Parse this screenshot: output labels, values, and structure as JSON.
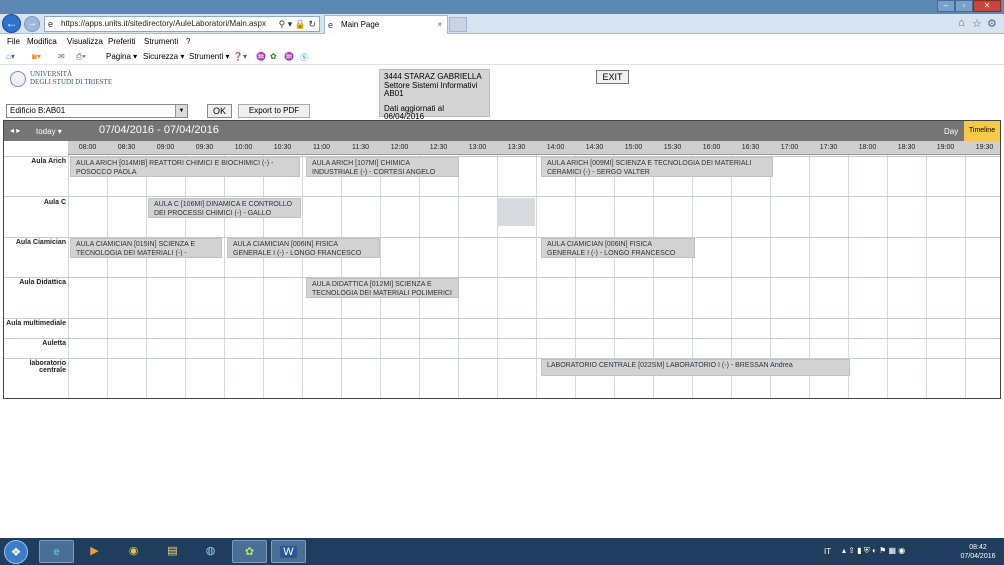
{
  "browser": {
    "address": "https://apps.units.it/sitedirectory/AuleLaboratori/Main.aspx",
    "tab_title": "Main Page",
    "tab_close": "×",
    "search_glyph": "⚲ ▾ 🔒 ↻"
  },
  "menu": [
    "File",
    "Modifica",
    "Visualizza",
    "Preferiti",
    "Strumenti",
    "?"
  ],
  "commandbar": {
    "pagina": "Pagina ▾",
    "sicurezza": "Sicurezza ▾",
    "strumenti": "Strumenti ▾"
  },
  "logo": {
    "line1": "UNIVERSITÀ",
    "line2": "DEGLI STUDI DI TRIESTE"
  },
  "user": {
    "line1": "3444  STARAZ  GABRIELLA",
    "line2": "Settore Sistemi Informativi",
    "line3": "AB01",
    "line4": "Dati aggiornati al 06/04/2016"
  },
  "exit_label": "EXIT",
  "building_select": "Edificio B:AB01",
  "ok_label": "OK",
  "pdf_label": "Export to PDF",
  "scheduler": {
    "nav": "◂ ▸",
    "today": "today  ▾",
    "range": "07/04/2016 - 07/04/2016",
    "day_view": "Day",
    "timeline_view": "Timeline",
    "times": [
      "08:00",
      "08:30",
      "09:00",
      "09:30",
      "10:00",
      "10:30",
      "11:00",
      "11:30",
      "12:00",
      "12:30",
      "13:00",
      "13:30",
      "14:00",
      "14:30",
      "15:00",
      "15:30",
      "16:00",
      "16:30",
      "17:00",
      "17:30",
      "18:00",
      "18:30",
      "19:00",
      "19:30"
    ],
    "rooms": [
      "Aula Arich",
      "Aula C",
      "Aula Ciamician",
      "Aula Didattica",
      "Aula multimediale",
      "Auletta",
      "laboratorio centrale"
    ],
    "events": [
      "AULA ARICH [014MIB] REATTORI CHIMICI E BIOCHIMICI (-) - POSOCCO PAOLA",
      "AULA ARICH [107MI] CHIMICA INDUSTRIALE (-) - CORTESI ANGELO",
      "AULA ARICH [009MI] SCIENZA E TECNOLOGIA DEI MATERIALI CERAMICI (-) - SERGO VALTER",
      "AULA C [106MI] DINAMICA E CONTROLLO DEI PROCESSI CHIMICI (-) - GALLO VITTORINO",
      "AULA CIAMICIAN [015IN] SCIENZA E TECNOLOGIA DEI MATERIALI (-) - SBAIZERO",
      "AULA CIAMICIAN [006IN] FISICA GENERALE I (-) - LONGO FRANCESCO",
      "AULA CIAMICIAN [006IN] FISICA GENERALE I (-) - LONGO FRANCESCO",
      "AULA DIDATTICA [012MI] SCIENZA E TECNOLOGIA DEI MATERIALI POLIMERICI (-) -",
      "LABORATORIO CENTRALE [022SM] LABORATORIO I (-) - BRESSAN Andrea"
    ]
  },
  "taskbar": {
    "lang": "IT",
    "time": "08:42",
    "date": "07/04/2016"
  },
  "colors": {
    "accent": "#f7c948",
    "header": "#757575",
    "event": "#d3d3d3",
    "taskbar": "#1f3d5c"
  }
}
